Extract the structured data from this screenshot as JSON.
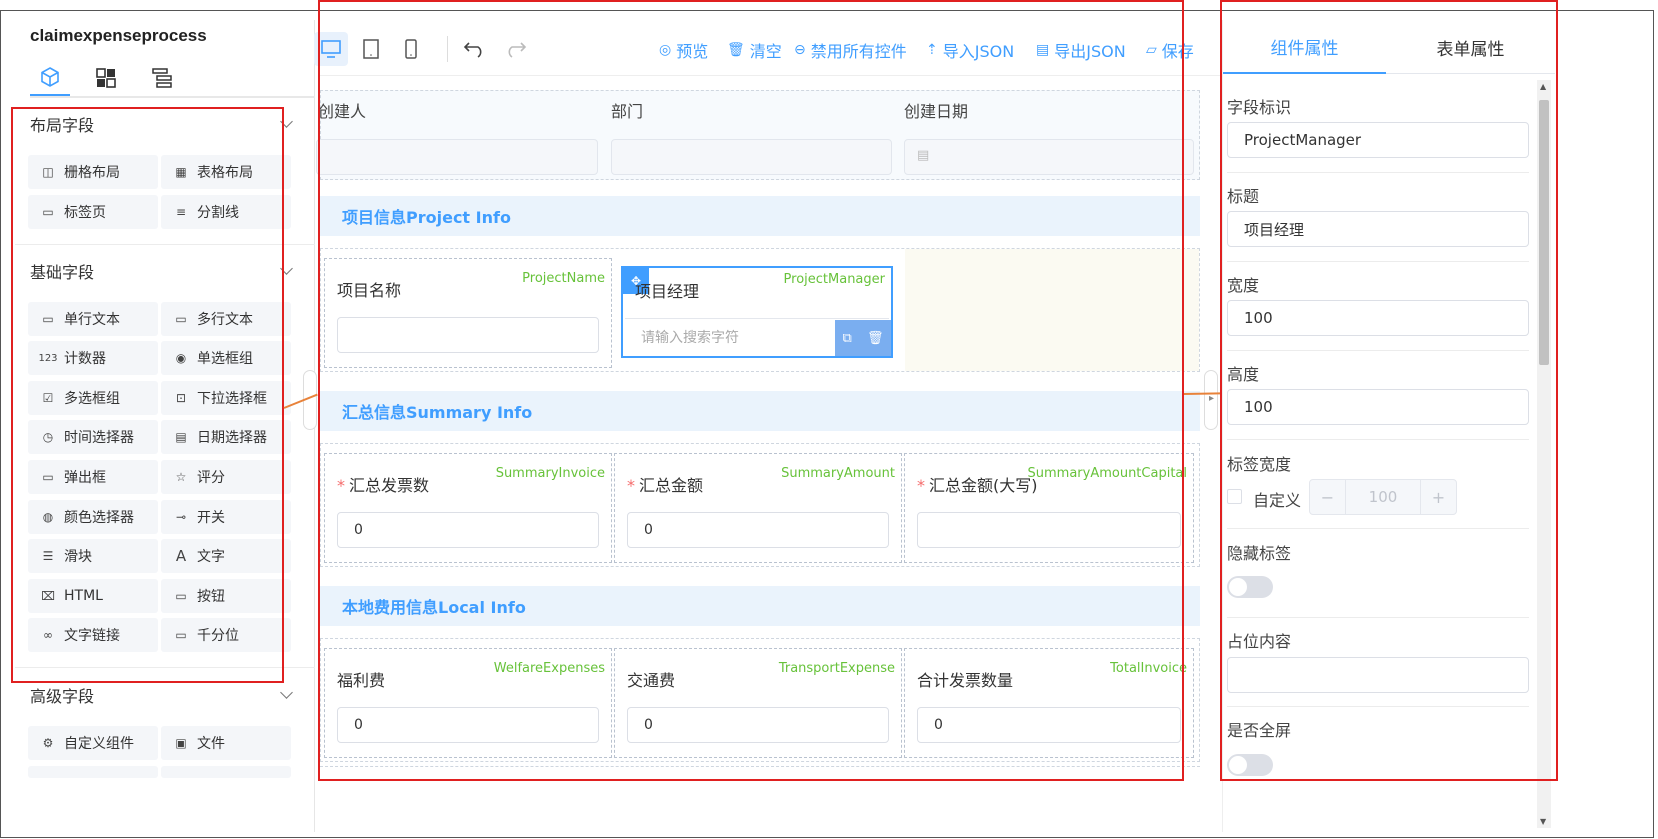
{
  "app": {
    "title": "claimexpenseprocess"
  },
  "left_panel": {
    "tabs": [
      {
        "icon": "cube-icon"
      },
      {
        "icon": "grid-icon"
      },
      {
        "icon": "tree-icon"
      }
    ],
    "sections": [
      {
        "title": "布局字段",
        "items": [
          {
            "label": "栅格布局",
            "icon": "columns-icon"
          },
          {
            "label": "表格布局",
            "icon": "table-icon"
          },
          {
            "label": "标签页",
            "icon": "tab-icon"
          },
          {
            "label": "分割线",
            "icon": "divider-icon"
          }
        ]
      },
      {
        "title": "基础字段",
        "items": [
          {
            "label": "单行文本",
            "icon": "input-icon"
          },
          {
            "label": "多行文本",
            "icon": "textarea-icon"
          },
          {
            "label": "计数器",
            "icon": "number-icon"
          },
          {
            "label": "单选框组",
            "icon": "radio-icon"
          },
          {
            "label": "多选框组",
            "icon": "checkbox-icon"
          },
          {
            "label": "下拉选择框",
            "icon": "select-icon"
          },
          {
            "label": "时间选择器",
            "icon": "clock-icon"
          },
          {
            "label": "日期选择器",
            "icon": "calendar-icon"
          },
          {
            "label": "弹出框",
            "icon": "popup-icon"
          },
          {
            "label": "评分",
            "icon": "star-icon"
          },
          {
            "label": "颜色选择器",
            "icon": "palette-icon"
          },
          {
            "label": "开关",
            "icon": "switch-icon"
          },
          {
            "label": "滑块",
            "icon": "slider-icon"
          },
          {
            "label": "文字",
            "icon": "text-icon"
          },
          {
            "label": "HTML",
            "icon": "html-icon"
          },
          {
            "label": "按钮",
            "icon": "button-icon"
          },
          {
            "label": "文字链接",
            "icon": "link-icon"
          },
          {
            "label": "千分位",
            "icon": "thousands-icon"
          }
        ]
      },
      {
        "title": "高级字段",
        "items": [
          {
            "label": "自定义组件",
            "icon": "plugin-icon"
          },
          {
            "label": "文件",
            "icon": "file-icon"
          }
        ]
      }
    ]
  },
  "toolbar": {
    "preview": "预览",
    "clear": "清空",
    "disable_all": "禁用所有控件",
    "import_json": "导入JSON",
    "export_json": "导出JSON",
    "save": "保存"
  },
  "form": {
    "header_fields": [
      {
        "label": "创建人"
      },
      {
        "label": "部门"
      },
      {
        "label": "创建日期"
      }
    ],
    "sections": [
      {
        "title": "项目信息Project Info",
        "fields": [
          {
            "label": "项目名称",
            "key": "ProjectName",
            "value": "",
            "required": false
          },
          {
            "label": "项目经理",
            "key": "ProjectManager",
            "placeholder": "请输入搜索字符",
            "required": false,
            "selected": true
          }
        ]
      },
      {
        "title": "汇总信息Summary Info",
        "fields": [
          {
            "label": "汇总发票数",
            "key": "SummaryInvoice",
            "value": "0",
            "required": true
          },
          {
            "label": "汇总金额",
            "key": "SummaryAmount",
            "value": "0",
            "required": true
          },
          {
            "label": "汇总金额(大写)",
            "key": "SummaryAmountCapital",
            "value": "",
            "required": true
          }
        ]
      },
      {
        "title": "本地费用信息Local Info",
        "fields": [
          {
            "label": "福利费",
            "key": "WelfareExpenses",
            "value": "0",
            "required": false
          },
          {
            "label": "交通费",
            "key": "TransportExpense",
            "value": "0",
            "required": false
          },
          {
            "label": "合计发票数量",
            "key": "TotalInvoice",
            "value": "0",
            "required": false
          }
        ]
      }
    ]
  },
  "right_panel": {
    "tabs": {
      "component": "组件属性",
      "form": "表单属性"
    },
    "props": {
      "field_id_label": "字段标识",
      "field_id_value": "ProjectManager",
      "title_label": "标题",
      "title_value": "项目经理",
      "width_label": "宽度",
      "width_value": "100",
      "height_label": "高度",
      "height_value": "100",
      "label_width_label": "标签宽度",
      "custom_label": "自定义",
      "label_width_value": "100",
      "hide_label_label": "隐藏标签",
      "placeholder_label": "占位内容",
      "fullscreen_label": "是否全屏"
    }
  },
  "colors": {
    "accent": "#409eff",
    "tag": "#67c23a",
    "required": "#f56c6c",
    "annotation": "#e02020",
    "arrow": "#e8823a"
  }
}
